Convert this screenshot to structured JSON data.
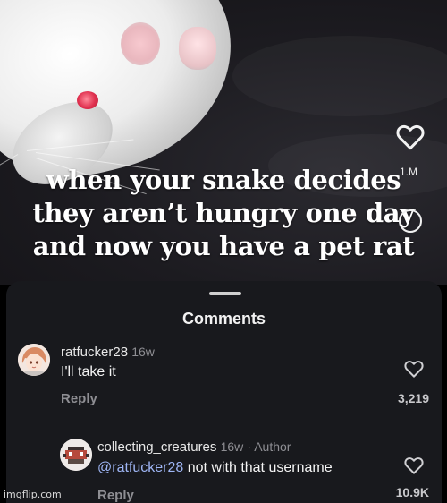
{
  "video": {
    "caption_lines": [
      "when your snake decides",
      "they aren’t hungry one day",
      "and now you have a pet rat"
    ],
    "like_count": "1.M",
    "icons": [
      "heart-icon",
      "comment-icon"
    ]
  },
  "comments_sheet": {
    "title": "Comments",
    "comments": [
      {
        "username": "ratfucker28",
        "age": "16w",
        "text": "I'll take it",
        "reply_label": "Reply",
        "likes": "3,219"
      },
      {
        "username": "collecting_creatures",
        "age": "16w",
        "author_tag": "· Author",
        "mention": "@ratfucker28",
        "text": " not with that username",
        "reply_label": "Reply",
        "likes": "10.9K"
      }
    ]
  },
  "watermark": "imgflip.com",
  "colors": {
    "sheet_bg": "#18191d",
    "mention": "#9fb6f5",
    "muted": "#8e8e93"
  }
}
